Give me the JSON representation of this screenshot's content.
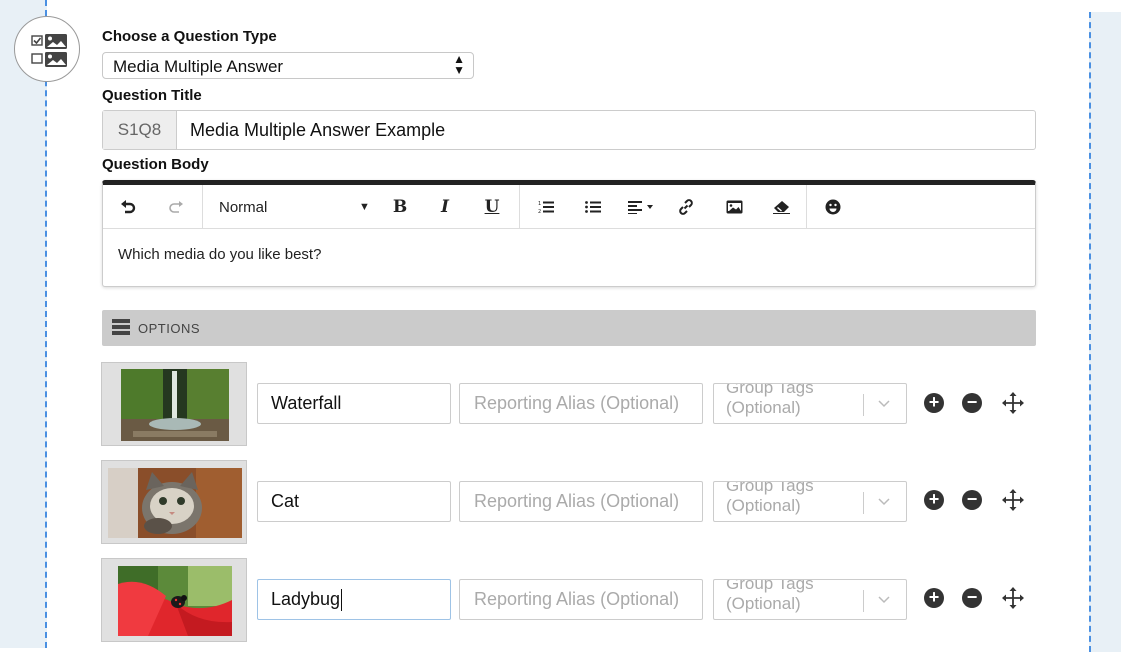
{
  "question_type": {
    "label": "Choose a Question Type",
    "value": "Media Multiple Answer"
  },
  "question_title": {
    "label": "Question Title",
    "prefix": "S1Q8",
    "value": "Media Multiple Answer Example"
  },
  "question_body": {
    "label": "Question Body",
    "toolbar": {
      "style_value": "Normal",
      "bold": "B",
      "italic": "I",
      "underline": "U"
    },
    "content": "Which media do you like best?"
  },
  "options_section": {
    "title": "OPTIONS"
  },
  "options": [
    {
      "image": "waterfall-image",
      "label": "Waterfall",
      "alias_placeholder": "Reporting Alias (Optional)",
      "tags_placeholder": "Group Tags (Optional)"
    },
    {
      "image": "cat-image",
      "label": "Cat",
      "alias_placeholder": "Reporting Alias (Optional)",
      "tags_placeholder": "Group Tags (Optional)"
    },
    {
      "image": "ladybug-image",
      "label": "Ladybug",
      "alias_placeholder": "Reporting Alias (Optional)",
      "tags_placeholder": "Group Tags (Optional)"
    }
  ],
  "icons": {
    "add": "plus-circle-icon",
    "remove": "minus-circle-icon",
    "move": "move-icon"
  },
  "colors": {
    "toolbar_top_border": "#222222",
    "options_bar": "#cbcbcb",
    "gutter": "#e8f0f6",
    "gutter_dash": "#4a90e2"
  }
}
